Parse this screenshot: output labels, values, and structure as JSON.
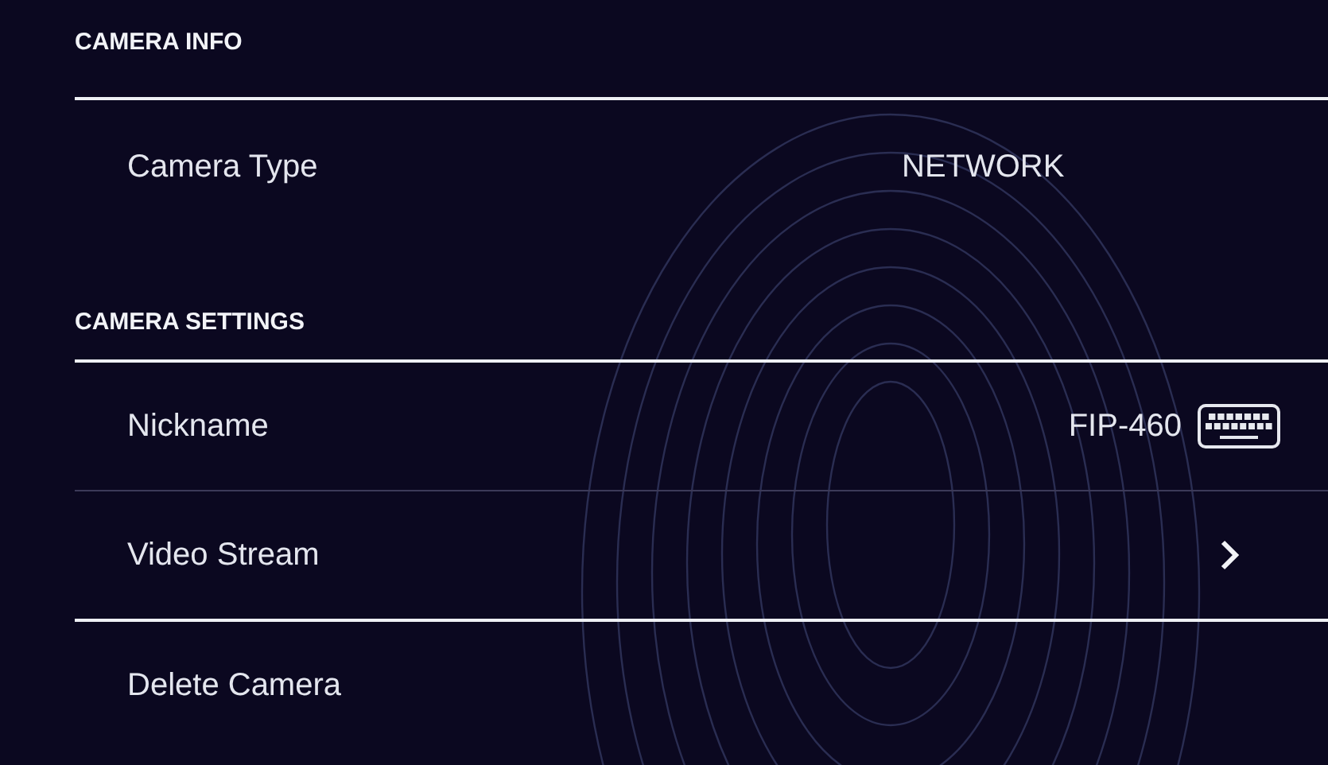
{
  "sections": [
    {
      "title": "CAMERA INFO",
      "rows": [
        {
          "kind": "text",
          "label": "Camera Type",
          "value": "NETWORK"
        }
      ]
    },
    {
      "title": "CAMERA SETTINGS",
      "rows": [
        {
          "kind": "field",
          "label": "Nickname",
          "value": "FIP-460"
        },
        {
          "kind": "link",
          "label": "Video Stream"
        }
      ]
    },
    {
      "rows": [
        {
          "kind": "action",
          "label": "Delete Camera"
        }
      ]
    }
  ]
}
